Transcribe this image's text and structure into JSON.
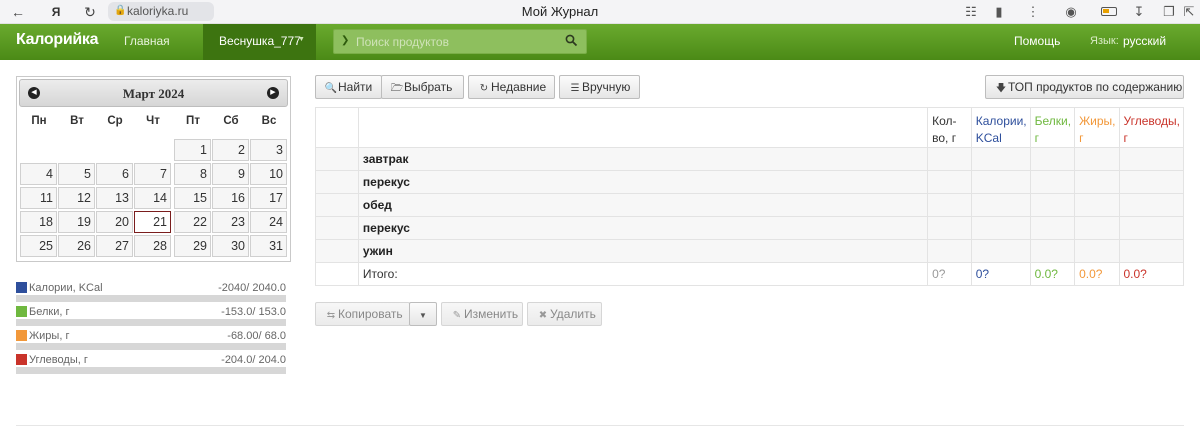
{
  "browser": {
    "url": "kaloriyka.ru",
    "page_title": "Мой Журнал"
  },
  "nav": {
    "brand": "Калорийка",
    "home": "Главная",
    "user": "Веснушка_777",
    "search_placeholder": "Поиск продуктов",
    "help": "Помощь",
    "lang_label": "Язык:",
    "lang_value": "русский"
  },
  "calendar": {
    "title": "Март 2024",
    "weekdays": [
      "Пн",
      "Вт",
      "Ср",
      "Чт",
      "Пт",
      "Сб",
      "Вс"
    ],
    "selected_day": "21",
    "weeks": [
      [
        "",
        "",
        "",
        "",
        "1",
        "2",
        "3"
      ],
      [
        "4",
        "5",
        "6",
        "7",
        "8",
        "9",
        "10"
      ],
      [
        "11",
        "12",
        "13",
        "14",
        "15",
        "16",
        "17"
      ],
      [
        "18",
        "19",
        "20",
        "21",
        "22",
        "23",
        "24"
      ],
      [
        "25",
        "26",
        "27",
        "28",
        "29",
        "30",
        "31"
      ]
    ]
  },
  "nutrition": [
    {
      "label": "Калории, KCal",
      "value": "-2040/ 2040.0",
      "color": "#2e4f9c",
      "fill": 0
    },
    {
      "label": "Белки, г",
      "value": "-153.0/ 153.0",
      "color": "#6fb83f",
      "fill": 0
    },
    {
      "label": "Жиры, г",
      "value": "-68.00/ 68.0",
      "color": "#f2983a",
      "fill": 0
    },
    {
      "label": "Углеводы, г",
      "value": "-204.0/ 204.0",
      "color": "#c9332a",
      "fill": 0
    }
  ],
  "toolbar": {
    "find": "Найти",
    "choose": "Выбрать",
    "recent": "Недавние",
    "manual": "Вручную",
    "top_products": "ТОП продуктов по содержанию"
  },
  "table": {
    "headers": {
      "qty": "Кол-во, г",
      "kcal": "Калории, KCal",
      "prot": "Белки, г",
      "fat": "Жиры, г",
      "carb": "Углеводы, г"
    },
    "meals": [
      "завтрак",
      "перекус",
      "обед",
      "перекус",
      "ужин"
    ],
    "total": {
      "label": "Итого:",
      "qty": "0?",
      "kcal": "0?",
      "prot": "0.0?",
      "fat": "0.0?",
      "carb": "0.0?"
    }
  },
  "actions": {
    "copy": "Копировать",
    "edit": "Изменить",
    "delete": "Удалить"
  }
}
